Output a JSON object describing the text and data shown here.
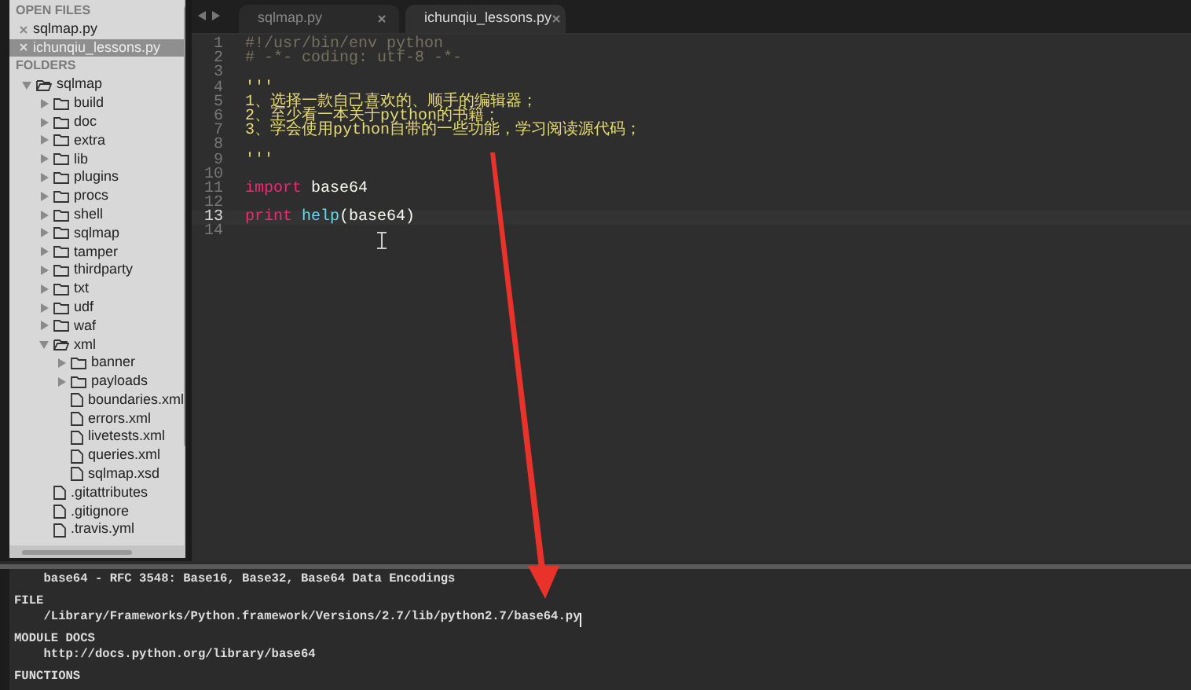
{
  "sidebar": {
    "open_files_heading": "OPEN FILES",
    "open_files": [
      {
        "name": "sqlmap.py",
        "selected": false
      },
      {
        "name": "ichunqiu_lessons.py",
        "selected": true
      }
    ],
    "folders_heading": "FOLDERS",
    "tree": [
      {
        "name": "sqlmap",
        "kind": "folder",
        "expanded": true,
        "children": [
          {
            "name": "build",
            "kind": "folder",
            "expanded": false
          },
          {
            "name": "doc",
            "kind": "folder",
            "expanded": false
          },
          {
            "name": "extra",
            "kind": "folder",
            "expanded": false
          },
          {
            "name": "lib",
            "kind": "folder",
            "expanded": false
          },
          {
            "name": "plugins",
            "kind": "folder",
            "expanded": false
          },
          {
            "name": "procs",
            "kind": "folder",
            "expanded": false
          },
          {
            "name": "shell",
            "kind": "folder",
            "expanded": false
          },
          {
            "name": "sqlmap",
            "kind": "folder",
            "expanded": false
          },
          {
            "name": "tamper",
            "kind": "folder",
            "expanded": false
          },
          {
            "name": "thirdparty",
            "kind": "folder",
            "expanded": false
          },
          {
            "name": "txt",
            "kind": "folder",
            "expanded": false
          },
          {
            "name": "udf",
            "kind": "folder",
            "expanded": false
          },
          {
            "name": "waf",
            "kind": "folder",
            "expanded": false
          },
          {
            "name": "xml",
            "kind": "folder",
            "expanded": true,
            "children": [
              {
                "name": "banner",
                "kind": "folder",
                "expanded": false
              },
              {
                "name": "payloads",
                "kind": "folder",
                "expanded": false
              },
              {
                "name": "boundaries.xml",
                "kind": "file"
              },
              {
                "name": "errors.xml",
                "kind": "file"
              },
              {
                "name": "livetests.xml",
                "kind": "file"
              },
              {
                "name": "queries.xml",
                "kind": "file"
              },
              {
                "name": "sqlmap.xsd",
                "kind": "file"
              }
            ]
          },
          {
            "name": ".gitattributes",
            "kind": "file"
          },
          {
            "name": ".gitignore",
            "kind": "file"
          },
          {
            "name": ".travis.yml",
            "kind": "file"
          }
        ]
      }
    ]
  },
  "editor": {
    "tabs": [
      {
        "label": "sqlmap.py",
        "selected": false
      },
      {
        "label": "ichunqiu_lessons.py",
        "selected": true
      }
    ],
    "lines": [
      {
        "number": "1",
        "selected": false,
        "tokens": [
          {
            "text": "#!/usr/bin/env python",
            "kind": "comment"
          }
        ]
      },
      {
        "number": "2",
        "selected": false,
        "tokens": [
          {
            "text": "# -*- coding: utf-8 -*-",
            "kind": "comment"
          }
        ]
      },
      {
        "number": "3",
        "selected": false
      },
      {
        "number": "4",
        "selected": false,
        "tokens": [
          {
            "text": "'''",
            "kind": "string"
          }
        ]
      },
      {
        "number": "5",
        "selected": false,
        "tokens": [
          {
            "text": "1、选择一款自己喜欢的、顺手的编辑器；",
            "kind": "string"
          }
        ]
      },
      {
        "number": "6",
        "selected": false,
        "tokens": [
          {
            "text": "2、至少看一本关于python的书籍；",
            "kind": "string"
          }
        ]
      },
      {
        "number": "7",
        "selected": false,
        "tokens": [
          {
            "text": "3、学会使用python自带的一些功能，学习阅读源代码；",
            "kind": "string"
          }
        ]
      },
      {
        "number": "8",
        "selected": false
      },
      {
        "number": "9",
        "selected": false,
        "tokens": [
          {
            "text": "'''",
            "kind": "string"
          }
        ]
      },
      {
        "number": "10",
        "selected": false
      },
      {
        "number": "11",
        "selected": false,
        "tokens": [
          {
            "text": "import",
            "kind": "keyword"
          },
          {
            "text": " base64",
            "kind": "plain"
          }
        ]
      },
      {
        "number": "12",
        "selected": false
      },
      {
        "number": "13",
        "selected": true,
        "tokens": [
          {
            "text": "print ",
            "kind": "keyword"
          },
          {
            "text": "help",
            "kind": "builtin"
          },
          {
            "text": "(base64)",
            "kind": "plain"
          }
        ]
      },
      {
        "number": "14",
        "selected": false
      }
    ]
  },
  "console": {
    "lines": [
      {
        "text": "    base64 - RFC 3548: Base16, Base32, Base64 Data Encodings",
        "kind": "body",
        "cursor": false
      },
      {
        "text": "FILE",
        "kind": "heading",
        "cursor": false
      },
      {
        "text": "    /Library/Frameworks/Python.framework/Versions/2.7/lib/python2.7/base64.py",
        "kind": "body",
        "cursor": true
      },
      {
        "text": "MODULE DOCS",
        "kind": "heading",
        "cursor": false
      },
      {
        "text": "    http://docs.python.org/library/base64",
        "kind": "body",
        "cursor": false
      },
      {
        "text": "FUNCTIONS",
        "kind": "heading",
        "cursor": false
      }
    ]
  }
}
